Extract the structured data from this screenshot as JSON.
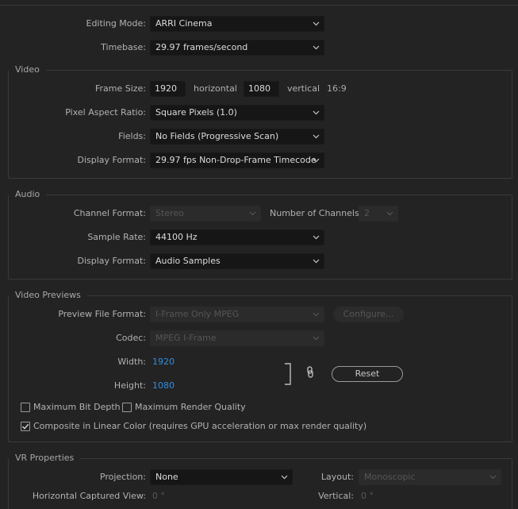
{
  "general": {
    "editing_mode_label": "Editing Mode:",
    "editing_mode_value": "ARRI Cinema",
    "timebase_label": "Timebase:",
    "timebase_value": "29.97  frames/second"
  },
  "video": {
    "title": "Video",
    "frame_size_label": "Frame Size:",
    "width": "1920",
    "horizontal_label": "horizontal",
    "height": "1080",
    "vertical_label": "vertical",
    "aspect": "16:9",
    "par_label": "Pixel Aspect Ratio:",
    "par_value": "Square Pixels (1.0)",
    "fields_label": "Fields:",
    "fields_value": "No Fields (Progressive Scan)",
    "display_format_label": "Display Format:",
    "display_format_value": "29.97 fps Non-Drop-Frame Timecode"
  },
  "audio": {
    "title": "Audio",
    "channel_format_label": "Channel Format:",
    "channel_format_value": "Stereo",
    "num_channels_label": "Number of Channels:",
    "num_channels_value": "2",
    "sample_rate_label": "Sample Rate:",
    "sample_rate_value": "44100 Hz",
    "display_format_label": "Display Format:",
    "display_format_value": "Audio Samples"
  },
  "previews": {
    "title": "Video Previews",
    "preview_format_label": "Preview File Format:",
    "preview_format_value": "I-Frame Only MPEG",
    "configure_label": "Configure...",
    "codec_label": "Codec:",
    "codec_value": "MPEG I-Frame",
    "width_label": "Width:",
    "width_value": "1920",
    "height_label": "Height:",
    "height_value": "1080",
    "reset_label": "Reset",
    "max_bit_depth_label": "Maximum Bit Depth",
    "max_render_quality_label": "Maximum Render Quality",
    "linear_color_label": "Composite in Linear Color (requires GPU acceleration or max render quality)"
  },
  "vr": {
    "title": "VR Properties",
    "projection_label": "Projection:",
    "projection_value": "None",
    "layout_label": "Layout:",
    "layout_value": "Monoscopic",
    "h_view_label": "Horizontal Captured View:",
    "h_view_value": "0 °",
    "vertical_label": "Vertical:",
    "vertical_value": "0 °"
  },
  "icons": {
    "dropdown": "chevron-down-icon",
    "link": "chain-link-icon",
    "check": "checkmark-icon"
  },
  "colors": {
    "accent_link": "#2f8fe0",
    "background": "#232323"
  }
}
